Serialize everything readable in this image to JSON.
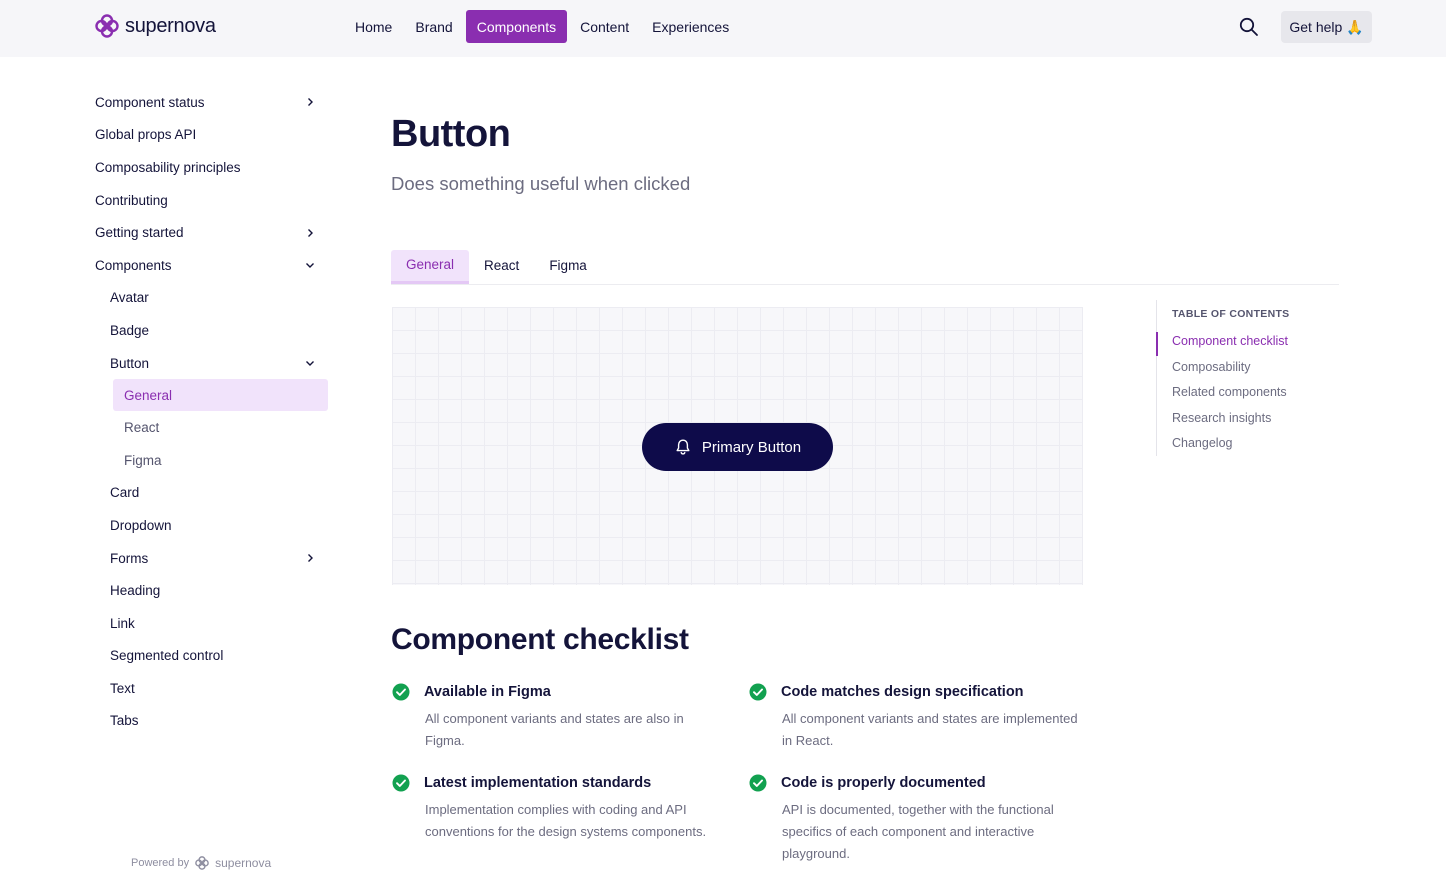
{
  "header": {
    "brand": "supernova",
    "nav": [
      "Home",
      "Brand",
      "Components",
      "Content",
      "Experiences"
    ],
    "active_nav": "Components",
    "help_label": "Get help 🙏",
    "accent": "#8a2eb0"
  },
  "sidebar": {
    "items": [
      {
        "label": "Component status",
        "level": 0,
        "chevron": "right"
      },
      {
        "label": "Global props API",
        "level": 0
      },
      {
        "label": "Composability principles",
        "level": 0
      },
      {
        "label": "Contributing",
        "level": 0
      },
      {
        "label": "Getting started",
        "level": 0,
        "chevron": "right"
      },
      {
        "label": "Components",
        "level": 0,
        "chevron": "down"
      },
      {
        "label": "Avatar",
        "level": 1
      },
      {
        "label": "Badge",
        "level": 1
      },
      {
        "label": "Button",
        "level": 1,
        "chevron": "down"
      },
      {
        "label": "General",
        "level": 2,
        "selected": true
      },
      {
        "label": "React",
        "level": 2
      },
      {
        "label": "Figma",
        "level": 2
      },
      {
        "label": "Card",
        "level": 1
      },
      {
        "label": "Dropdown",
        "level": 1
      },
      {
        "label": "Forms",
        "level": 1,
        "chevron": "right"
      },
      {
        "label": "Heading",
        "level": 1
      },
      {
        "label": "Link",
        "level": 1
      },
      {
        "label": "Segmented control",
        "level": 1
      },
      {
        "label": "Text",
        "level": 1
      },
      {
        "label": "Tabs",
        "level": 1
      }
    ],
    "powered_by": "Powered by",
    "powered_brand": "supernova"
  },
  "main": {
    "title": "Button",
    "subtitle": "Does something useful when clicked",
    "tabs": [
      "General",
      "React",
      "Figma"
    ],
    "active_tab": "General",
    "preview_button_label": "Primary Button",
    "section_title": "Component checklist",
    "checklist": [
      {
        "title": "Available in Figma",
        "desc": "All component variants and states are also in Figma."
      },
      {
        "title": "Code matches design specification",
        "desc": "All component variants and states are implemented in React."
      },
      {
        "title": "Latest implementation standards",
        "desc": "Implementation complies with coding and API conventions for the design systems components."
      },
      {
        "title": "Code is properly documented",
        "desc": "API is documented, together with the functional specifics of each component and interactive playground."
      }
    ]
  },
  "toc": {
    "heading": "TABLE OF CONTENTS",
    "items": [
      "Component checklist",
      "Composability",
      "Related components",
      "Research insights",
      "Changelog"
    ],
    "active": "Component checklist"
  }
}
